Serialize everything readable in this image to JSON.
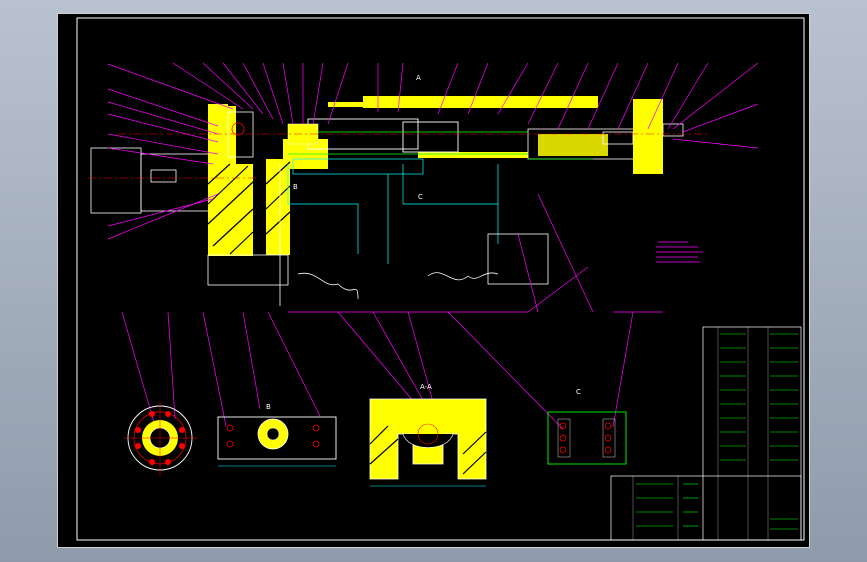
{
  "viewer": {
    "background": "#000000",
    "border_color": "#cfcfcf"
  },
  "colors": {
    "frame": "#ffffff",
    "leader": "#ff00ff",
    "part_fill": "#ffff00",
    "outline": "#ffffff",
    "hidden": "#00ffff",
    "center": "#ff0000",
    "green": "#00ff00",
    "notes": "#ff00ff"
  },
  "drawing": {
    "view_label_a": "A",
    "view_label_b": "B",
    "view_label_c": "C",
    "section_label": "A-A",
    "view_top_label": "B",
    "view_right_label": "C"
  },
  "title_block": {
    "rows": 16
  }
}
